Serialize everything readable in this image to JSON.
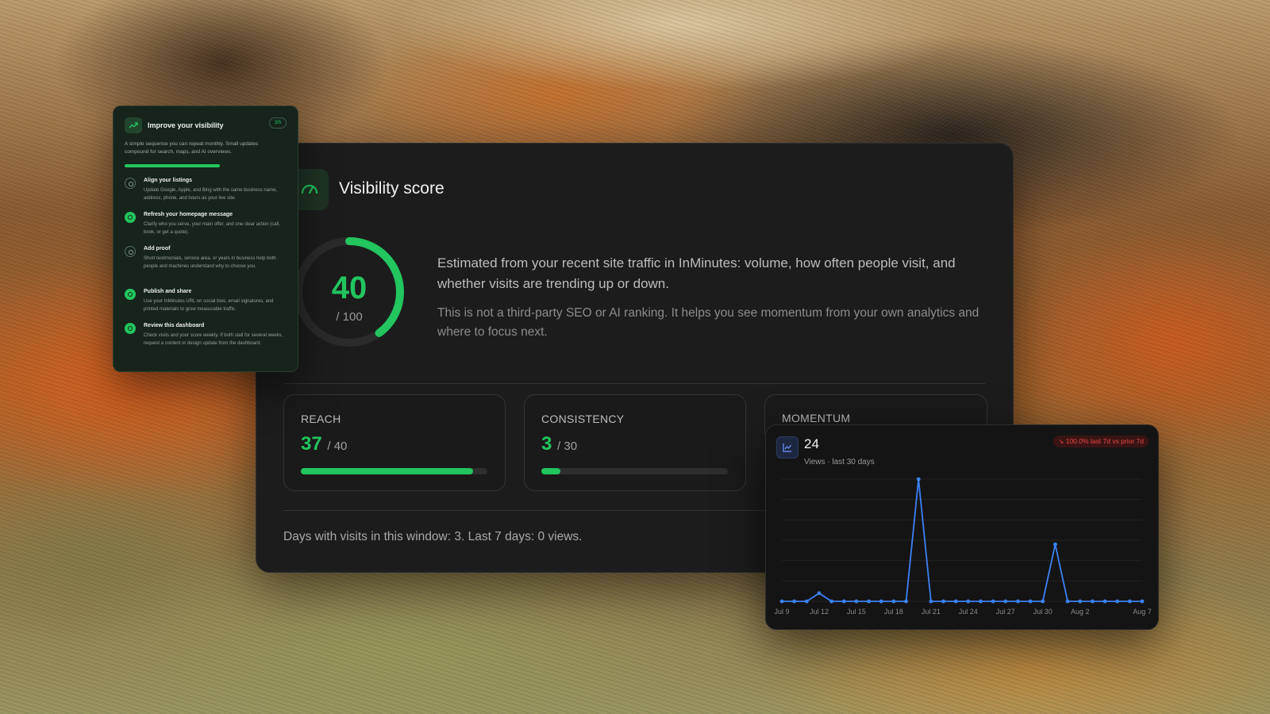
{
  "visibility": {
    "title": "Visibility score",
    "score": "40",
    "score_value": 40,
    "score_max": "/ 100",
    "description": "Estimated from your recent site traffic in InMinutes: volume, how often people visit, and whether visits are trending up or down.",
    "note": "This is not a third-party SEO or AI ranking. It helps you see momentum from your own analytics and where to focus next.",
    "metrics": [
      {
        "label": "REACH",
        "value": "37",
        "max": "/ 40",
        "fraction": 0.925
      },
      {
        "label": "CONSISTENCY",
        "value": "3",
        "max": "/ 30",
        "fraction": 0.1
      },
      {
        "label": "MOMENTUM"
      }
    ],
    "footer": "Days with visits in this window: 3. Last 7 days: 0 views.",
    "accent": "#22c55e"
  },
  "improve": {
    "title": "Improve your visibility",
    "badge": "3/5",
    "subtitle": "A simple sequence you can repeat monthly. Small updates compound for search, maps, and AI overviews.",
    "progress": 0.6,
    "steps": [
      {
        "title": "Align your listings",
        "desc": "Update Google, Apple, and Bing with the same business name, address, phone, and hours as your live site.",
        "done": false
      },
      {
        "title": "Refresh your homepage message",
        "desc": "Clarify who you serve, your main offer, and one clear action (call, book, or get a quote).",
        "done": true
      },
      {
        "title": "Add proof",
        "desc": "Short testimonials, service area, or years in business help both people and machines understand why to choose you.",
        "done": false
      },
      {
        "title": "Publish and share",
        "desc": "Use your InMinutes URL on social bios, email signatures, and printed materials to grow measurable traffic.",
        "done": true
      },
      {
        "title": "Review this dashboard",
        "desc": "Check visits and your score weekly. If both stall for several weeks, request a content or design update from the dashboard.",
        "done": true
      }
    ]
  },
  "momentum": {
    "value": "24",
    "subtitle": "Views · last 30 days",
    "badge": "↘ 100.0% last 7d vs prior 7d",
    "badge_color": "#ef4444",
    "line_color": "#3b82f6"
  },
  "chart_data": {
    "type": "line",
    "x": [
      "Jul 9",
      "Jul 10",
      "Jul 11",
      "Jul 12",
      "Jul 13",
      "Jul 14",
      "Jul 15",
      "Jul 16",
      "Jul 17",
      "Jul 18",
      "Jul 19",
      "Jul 20",
      "Jul 21",
      "Jul 22",
      "Jul 23",
      "Jul 24",
      "Jul 25",
      "Jul 26",
      "Jul 27",
      "Jul 28",
      "Jul 29",
      "Jul 30",
      "Jul 31",
      "Aug 1",
      "Aug 2",
      "Aug 3",
      "Aug 4",
      "Aug 5",
      "Aug 6",
      "Aug 7"
    ],
    "series": [
      {
        "values": [
          0,
          0,
          0,
          1,
          0,
          0,
          0,
          0,
          0,
          0,
          0,
          15,
          0,
          0,
          0,
          0,
          0,
          0,
          0,
          0,
          0,
          0,
          7,
          0,
          0,
          0,
          0,
          0,
          0,
          0
        ]
      }
    ],
    "tick_labels": [
      "Jul 9",
      "Jul 12",
      "Jul 15",
      "Jul 18",
      "Jul 21",
      "Jul 24",
      "Jul 27",
      "Jul 30",
      "Aug 2",
      "Aug 7"
    ],
    "ylim": [
      0,
      15
    ],
    "grid": true
  }
}
